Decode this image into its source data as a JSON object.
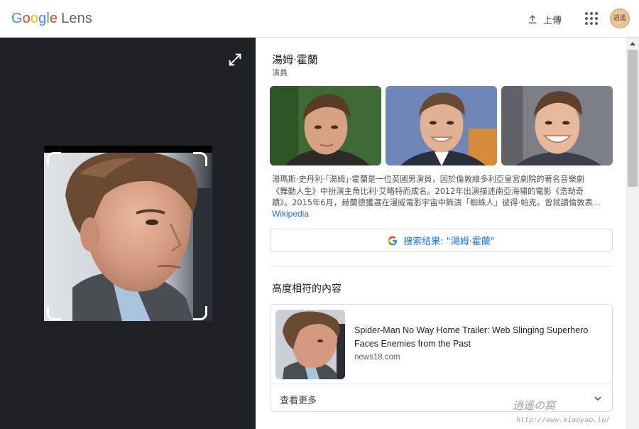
{
  "app": {
    "title_part1": "Google",
    "title_part2": "Lens",
    "upload_label": "上傳",
    "avatar_text": "逍遙"
  },
  "icons": {
    "upload": "upload-icon",
    "apps": "apps-grid-icon",
    "expand": "expand-icon",
    "google": "google-g-icon",
    "chevron": "chevron-down-icon"
  },
  "colors": {
    "google_blue": "#4285f4",
    "google_red": "#ea4335",
    "google_yellow": "#fbbc05",
    "google_green": "#34a853",
    "link_blue": "#1a73e8",
    "left_pane_bg": "#202124"
  },
  "knowledge_panel": {
    "title": "湯姆·霍蘭",
    "subtitle": "演員",
    "description": [
      "湯瑪斯·史丹利·「湯姆」·霍蘭是一位英國男演員，因於倫敦維多利亞皇宮劇院的著名音樂劇",
      "《舞動人生》中扮演主角比利·艾略特而成名。2012年出演描述南亞海嘯的電影《浩劫奇",
      "蹟》。2015年6月，赫蘭德獲選在漫威電影宇宙中飾演「蜘蛛人」彼得·帕克。曾就讀倫敦表..."
    ],
    "source": "Wikipedia",
    "search_button": "搜索结果: \"湯姆·霍蘭\""
  },
  "matches": {
    "section_title": "高度相符的內容",
    "items": [
      {
        "title": "Spider-Man No Way Home Trailer: Web Slinging Superhero Faces Enemies from the Past",
        "domain": "news18.com"
      }
    ],
    "more_label": "查看更多"
  },
  "watermark": {
    "text": "逍遙の窩",
    "url": "http://www.xiaoyao.tw/"
  }
}
